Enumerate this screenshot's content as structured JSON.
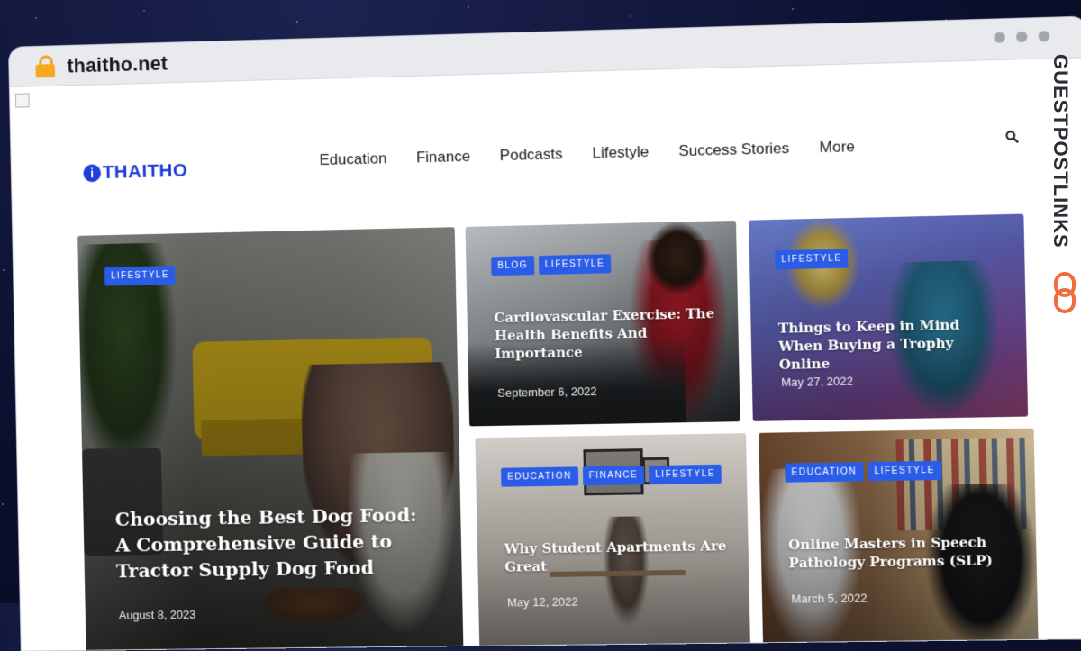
{
  "browser": {
    "url": "thaitho.net",
    "window_dots": 3
  },
  "brand": {
    "logo_text": "THAITHO",
    "logo_mark": "i",
    "watermark": "GUESTPOSTLINKS"
  },
  "nav": {
    "items": [
      "Education",
      "Finance",
      "Podcasts",
      "Lifestyle",
      "Success Stories",
      "More"
    ]
  },
  "articles": [
    {
      "tags": [
        "LIFESTYLE"
      ],
      "title": "Choosing the Best Dog Food: A Comprehensive Guide to Tractor Supply Dog Food",
      "date": "August 8, 2023"
    },
    {
      "tags": [
        "BLOG",
        "LIFESTYLE"
      ],
      "title": "Cardiovascular Exercise: The Health Benefits And Importance",
      "date": "September 6, 2022"
    },
    {
      "tags": [
        "LIFESTYLE"
      ],
      "title": "Things to Keep in Mind When Buying a Trophy Online",
      "date": "May 27, 2022"
    },
    {
      "tags": [
        "EDUCATION",
        "FINANCE",
        "LIFESTYLE"
      ],
      "title": "Why Student Apartments Are Great",
      "date": "May 12, 2022"
    },
    {
      "tags": [
        "EDUCATION",
        "LIFESTYLE"
      ],
      "title": "Online Masters in Speech Pathology Programs (SLP)",
      "date": "March 5, 2022"
    }
  ],
  "colors": {
    "brand_blue": "#1f3fd6",
    "tag_blue": "#2b5ce8",
    "lock_orange": "#f6a821",
    "watermark_orange": "#f26a3d"
  }
}
